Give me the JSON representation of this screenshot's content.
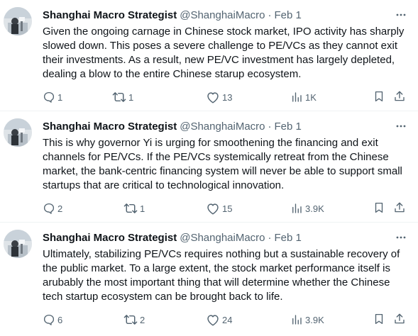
{
  "colors": {
    "text": "#0f1419",
    "secondary": "#536471",
    "divider": "#eff3f4"
  },
  "tweets": [
    {
      "author": "Shanghai Macro Strategist",
      "handle": "@ShanghaiMacro",
      "separator": "·",
      "date": "Feb 1",
      "text": "Given the ongoing carnage in Chinese stock market, IPO activity has sharply slowed down. This poses a severe challenge to PE/VCs as they cannot exit their investments. As a result, new PE/VC investment has largely depleted, dealing a blow to the entire Chinese starup ecosystem.",
      "replies": "1",
      "retweets": "1",
      "likes": "13",
      "views": "1K",
      "icons": [
        "reply-icon",
        "retweet-icon",
        "like-icon",
        "views-icon",
        "bookmark-icon",
        "share-icon"
      ]
    },
    {
      "author": "Shanghai Macro Strategist",
      "handle": "@ShanghaiMacro",
      "separator": "·",
      "date": "Feb 1",
      "text": "This is why governor Yi is urging for smoothening the financing and exit channels for PE/VCs. If the PE/VCs systemically retreat from the Chinese market, the bank-centric financing system will never be able to support small startups that are critical to technological innovation.",
      "replies": "2",
      "retweets": "1",
      "likes": "15",
      "views": "3.9K",
      "icons": [
        "reply-icon",
        "retweet-icon",
        "like-icon",
        "views-icon",
        "bookmark-icon",
        "share-icon"
      ]
    },
    {
      "author": "Shanghai Macro Strategist",
      "handle": "@ShanghaiMacro",
      "separator": "·",
      "date": "Feb 1",
      "text": "Ultimately, stabilizing PE/VCs requires nothing but a sustainable recovery of the public market. To a large extent, the stock market performance itself is arubably the most important thing that will determine whether the Chinese tech startup ecosystem can be brought back to life.",
      "replies": "6",
      "retweets": "2",
      "likes": "24",
      "views": "3.9K",
      "icons": [
        "reply-icon",
        "retweet-icon",
        "like-icon",
        "views-icon",
        "bookmark-icon",
        "share-icon"
      ]
    }
  ]
}
